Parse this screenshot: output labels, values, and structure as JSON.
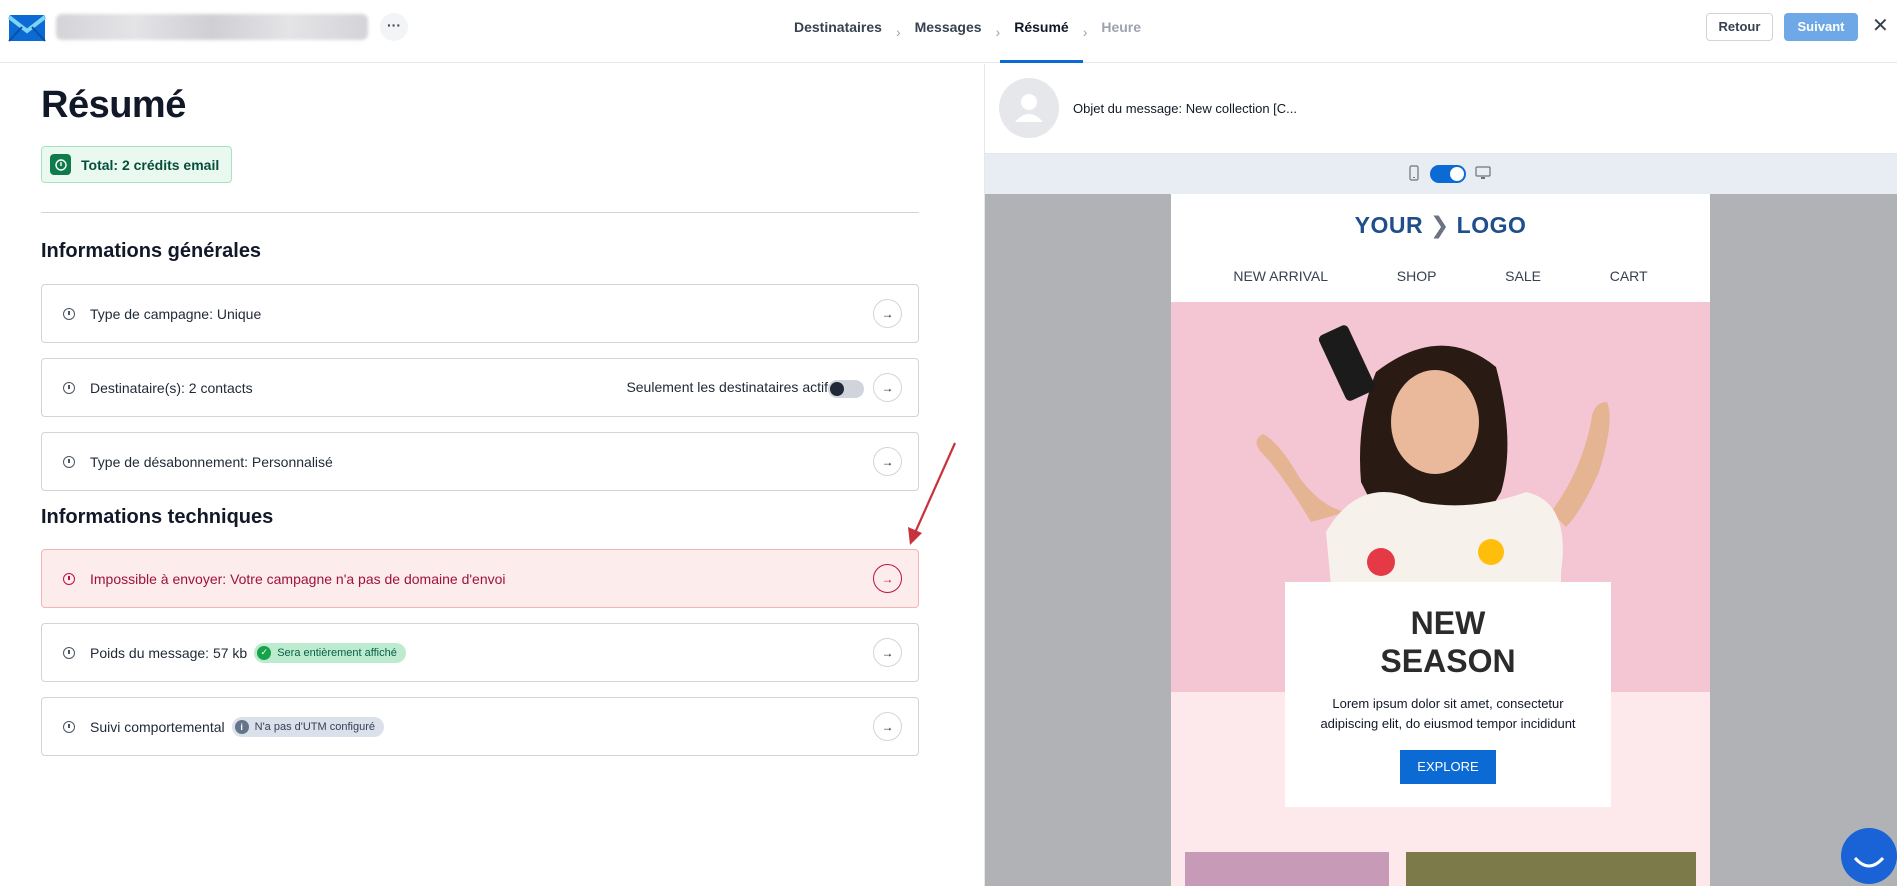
{
  "header": {
    "steps": [
      {
        "label": "Destinataires",
        "state": "done"
      },
      {
        "label": "Messages",
        "state": "done"
      },
      {
        "label": "Résumé",
        "state": "active"
      },
      {
        "label": "Heure",
        "state": "disabled"
      }
    ],
    "step_separator": "›",
    "more_label": "···",
    "back_label": "Retour",
    "next_label": "Suivant",
    "close_label": "✕",
    "accent_color": "#0b6ad4"
  },
  "summary": {
    "title": "Résumé",
    "credits": "Total: 2 crédits email",
    "general_title": "Informations générales",
    "general_items": [
      {
        "label": "Type de campagne: Unique"
      },
      {
        "label": "Destinataire(s): 2 contacts",
        "toggle_label": "Seulement les destinataires actifs",
        "toggle_on": false
      },
      {
        "label": "Type de désabonnement: Personnalisé"
      }
    ],
    "technical_title": "Informations techniques",
    "technical_items": [
      {
        "label": "Impossible à envoyer: Votre campagne n'a pas de domaine d'envoi",
        "status": "error"
      },
      {
        "label": "Poids du message: 57 kb",
        "badge": "Sera entièrement affiché",
        "badge_color": "green"
      },
      {
        "label": "Suivi comportemental",
        "badge": "N'a pas d'UTM configuré",
        "badge_color": "gray"
      }
    ],
    "arrow_glyph": "→"
  },
  "preview": {
    "subject": "Objet du message: New collection [C...",
    "device_mode": "desktop",
    "email": {
      "logo_left": "YOUR",
      "logo_chevron": "❯",
      "logo_right": "LOGO",
      "nav": [
        "NEW ARRIVAL",
        "SHOP",
        "SALE",
        "CART"
      ],
      "hero_title_line1": "NEW",
      "hero_title_line2": "SEASON",
      "hero_text": "Lorem ipsum dolor sit amet, consectetur adipiscing elit, do eiusmod tempor incididunt",
      "cta": "EXPLORE"
    }
  }
}
